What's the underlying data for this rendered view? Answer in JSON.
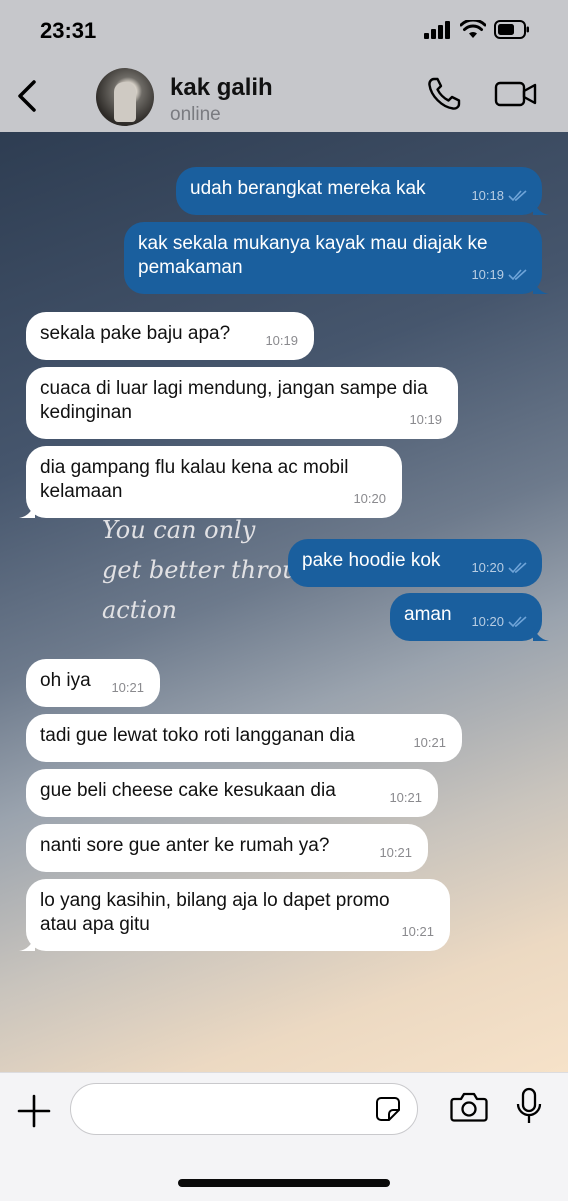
{
  "status_bar": {
    "time": "23:31"
  },
  "header": {
    "contact_name": "kak galih",
    "contact_status": "online"
  },
  "wallpaper": {
    "lines": [
      "You can only",
      "get better through",
      "action"
    ]
  },
  "messages": [
    {
      "dir": "out",
      "text": "udah berangkat mereka kak",
      "time": "10:18"
    },
    {
      "dir": "out",
      "text": "kak sekala mukanya kayak mau diajak ke pemakaman",
      "time": "10:19"
    },
    {
      "dir": "in",
      "text": "sekala pake baju apa?",
      "time": "10:19"
    },
    {
      "dir": "in",
      "text": "cuaca di luar lagi mendung, jangan sampe dia kedinginan",
      "time": "10:19"
    },
    {
      "dir": "in",
      "text": "dia gampang flu kalau kena ac mobil kelamaan",
      "time": "10:20"
    },
    {
      "dir": "out",
      "text": "pake hoodie kok",
      "time": "10:20"
    },
    {
      "dir": "out",
      "text": "aman",
      "time": "10:20"
    },
    {
      "dir": "in",
      "text": "oh iya",
      "time": "10:21"
    },
    {
      "dir": "in",
      "text": "tadi gue lewat toko roti langganan dia",
      "time": "10:21"
    },
    {
      "dir": "in",
      "text": "gue beli cheese cake kesukaan dia",
      "time": "10:21"
    },
    {
      "dir": "in",
      "text": "nanti sore gue anter ke rumah ya?",
      "time": "10:21"
    },
    {
      "dir": "in",
      "text": "lo yang kasihin, bilang aja lo dapet promo atau apa gitu",
      "time": "10:21"
    }
  ],
  "input": {
    "placeholder": ""
  },
  "icons": {
    "back": "chevron-left-icon",
    "call": "phone-icon",
    "video": "video-camera-icon",
    "attach": "plus-icon",
    "sticker": "sticker-icon",
    "camera": "camera-icon",
    "mic": "microphone-icon",
    "read": "double-check-icon"
  },
  "colors": {
    "outgoing_bubble": "#1a5f9e",
    "incoming_bubble": "#ffffff",
    "header_bg": "#c6c7cb"
  }
}
